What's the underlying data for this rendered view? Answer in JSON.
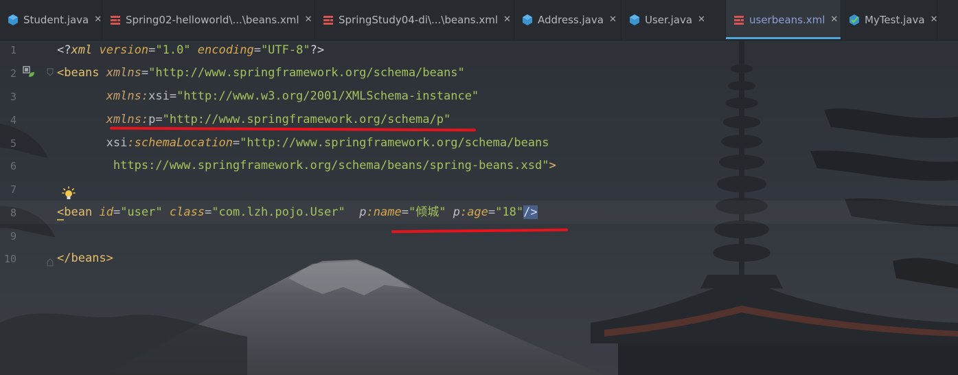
{
  "tabs": [
    {
      "label": "Student.java",
      "icon": "java-class-icon",
      "active": false
    },
    {
      "label": "Spring02-helloworld\\...\\beans.xml",
      "icon": "xml-file-icon",
      "active": false
    },
    {
      "label": "SpringStudy04-di\\...\\beans.xml",
      "icon": "xml-file-icon",
      "active": false
    },
    {
      "label": "Address.java",
      "icon": "java-class-icon",
      "active": false
    },
    {
      "label": "User.java",
      "icon": "java-class-icon",
      "active": false
    },
    {
      "label": "userbeans.xml",
      "icon": "xml-file-icon",
      "active": true
    },
    {
      "label": "MyTest.java",
      "icon": "java-test-icon",
      "active": false
    }
  ],
  "tab_close": "✕",
  "line_numbers": [
    "1",
    "2",
    "3",
    "4",
    "5",
    "6",
    "7",
    "8",
    "9",
    "10"
  ],
  "code": {
    "l1": {
      "open": "<?",
      "tag": "xml",
      "a1": "version",
      "eq1": "=",
      "v1": "\"1.0\"",
      "a2": "encoding",
      "eq2": "=",
      "v2": "\"UTF-8\"",
      "close": "?>"
    },
    "l2": {
      "lt": "<",
      "tag": "beans",
      "ns": "xmlns",
      "eq": "=",
      "val": "\"http://www.springframework.org/schema/beans\""
    },
    "l3": {
      "ns": "xmlns",
      "colon": ":",
      "attr": "xsi",
      "eq": "=",
      "val": "\"http://www.w3.org/2001/XMLSchema-instance\""
    },
    "l4": {
      "ns": "xmlns",
      "colon": ":",
      "attr": "p",
      "eq": "=",
      "val": "\"http://www.springframework.org/schema/p\""
    },
    "l5": {
      "attr": "xsi",
      "colon": ":",
      "name": "schemaLocation",
      "eq": "=",
      "val": "\"http://www.springframework.org/schema/beans"
    },
    "l6": {
      "val": "https://www.springframework.org/schema/beans/spring-beans.xsd\"",
      "gt": ">"
    },
    "l8": {
      "lt": "<",
      "tag": "bean",
      "a1": "id",
      "eq1": "=",
      "v1": "\"user\"",
      "a2": "class",
      "eq2": "=",
      "v2": "\"com.lzh.pojo.User\"",
      "p1ns": "p",
      "c1": ":",
      "p1": "name",
      "eq3": "=",
      "v3": "\"倾城\"",
      "p2ns": "p",
      "c2": ":",
      "p2": "age",
      "eq4": "=",
      "v4": "\"18\"",
      "end": "/>"
    },
    "l10": {
      "lt": "</",
      "tag": "beans",
      "gt": ">"
    }
  },
  "colors": {
    "tag": "#e8bf6a",
    "attribute_value": "#a5c25c",
    "namespace": "#c9a26b",
    "active_tab_underline": "#4ea7d8",
    "annotation_underline": "#e8141d"
  }
}
